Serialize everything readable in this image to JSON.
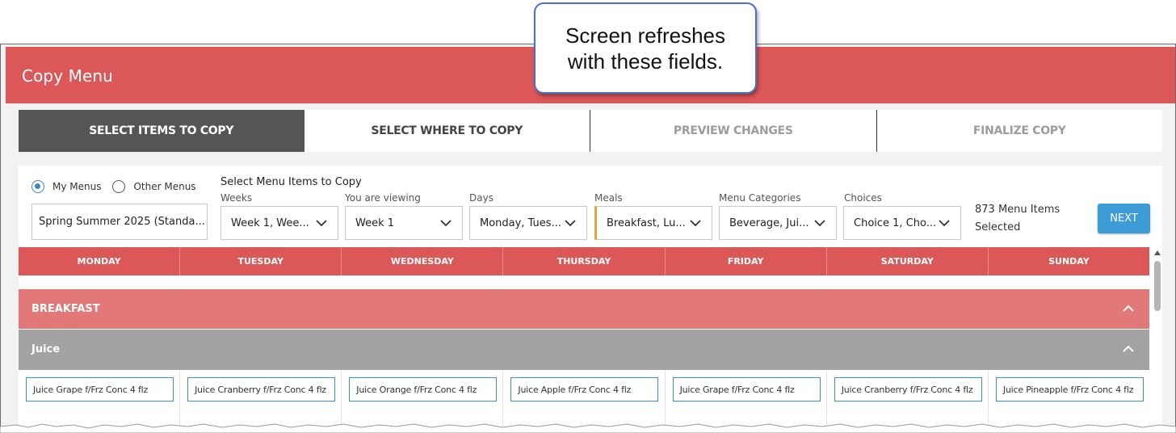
{
  "app": {
    "title": "Copy Menu"
  },
  "callout": {
    "text": "Screen refreshes with these fields."
  },
  "steps": [
    {
      "label": "SELECT ITEMS TO COPY",
      "state": "active"
    },
    {
      "label": "SELECT WHERE TO COPY",
      "state": "normal"
    },
    {
      "label": "PREVIEW CHANGES",
      "state": "disabled"
    },
    {
      "label": "FINALIZE COPY",
      "state": "disabled"
    }
  ],
  "menu_source": {
    "options": [
      {
        "label": "My Menus",
        "checked": true
      },
      {
        "label": "Other Menus",
        "checked": false
      }
    ],
    "selected_menu": "Spring Summer 2025 (Standa..."
  },
  "filters": {
    "section_label": "Select Menu Items to Copy",
    "weeks": {
      "label": "Weeks",
      "value": "Week 1, Wee..."
    },
    "viewing": {
      "label": "You are viewing",
      "value": "Week 1"
    },
    "days": {
      "label": "Days",
      "value": "Monday, Tues..."
    },
    "meals": {
      "label": "Meals",
      "value": "Breakfast, Lu..."
    },
    "categories": {
      "label": "Menu Categories",
      "value": "Beverage, Jui..."
    },
    "choices": {
      "label": "Choices",
      "value": "Choice 1, Cho..."
    }
  },
  "summary": {
    "line1": "873 Menu Items",
    "line2": "Selected"
  },
  "next_button": "NEXT",
  "day_headers": [
    "MONDAY",
    "TUESDAY",
    "WEDNESDAY",
    "THURSDAY",
    "FRIDAY",
    "SATURDAY",
    "SUNDAY"
  ],
  "meal_section": "BREAKFAST",
  "category_section": "Juice",
  "items": [
    "Juice Grape f/Frz Conc 4 flz",
    "Juice Cranberry f/Frz Conc 4 flz",
    "Juice Orange f/Frz Conc 4 flz",
    "Juice Apple f/Frz Conc 4 flz",
    "Juice Grape f/Frz Conc 4 flz",
    "Juice Cranberry f/Frz Conc 4 flz",
    "Juice Pineapple f/Frz Conc 4 flz"
  ],
  "colors": {
    "header_red": "#dc5757",
    "breakfast_bar": "#e27878",
    "juice_bar": "#a3a3a3",
    "active_step": "#555555",
    "next_button": "#3d9bd6",
    "meals_highlight": "#e8a33a",
    "callout_border": "#4b6fd1"
  },
  "icons": {
    "dropdown": "chevron-down-icon",
    "collapse": "chevron-up-icon"
  }
}
